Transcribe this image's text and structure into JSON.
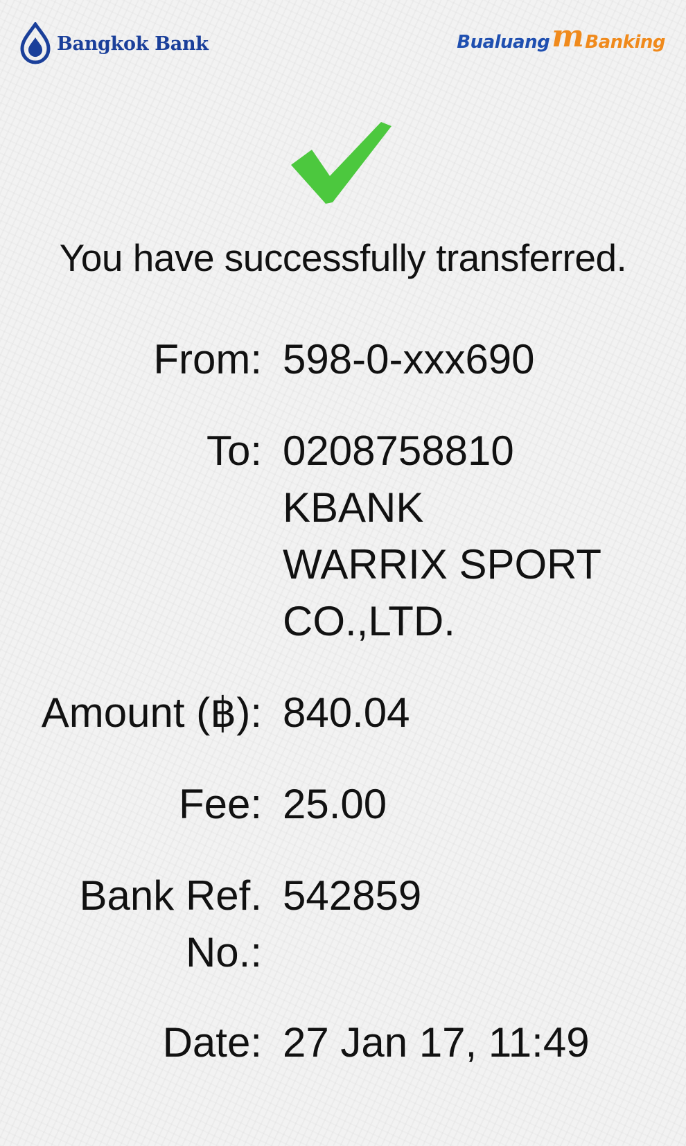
{
  "header": {
    "bank_name": "Bangkok Bank",
    "app_logo": {
      "part1": "Bualuang",
      "part2": "m",
      "part3": "Banking"
    },
    "colors": {
      "bank_blue": "#1a3f9a",
      "app_blue": "#1f4fb0",
      "app_orange": "#f08a1c"
    }
  },
  "status": {
    "icon": "check-mark-icon",
    "color": "#4cc83e",
    "message": "You have successfully transferred."
  },
  "details": {
    "from_label": "From:",
    "from_value": "598-0-xxx690",
    "to_label": "To:",
    "to_account": "0208758810",
    "to_bank": "KBANK",
    "to_name_line1": "WARRIX SPORT",
    "to_name_line2": "CO.,LTD.",
    "amount_label": "Amount (฿):",
    "amount_value": "840.04",
    "fee_label": "Fee:",
    "fee_value": "25.00",
    "ref_label_line1": "Bank Ref.",
    "ref_label_line2": "No.:",
    "ref_value": "542859",
    "date_label": "Date:",
    "date_value": "27 Jan 17, 11:49"
  }
}
